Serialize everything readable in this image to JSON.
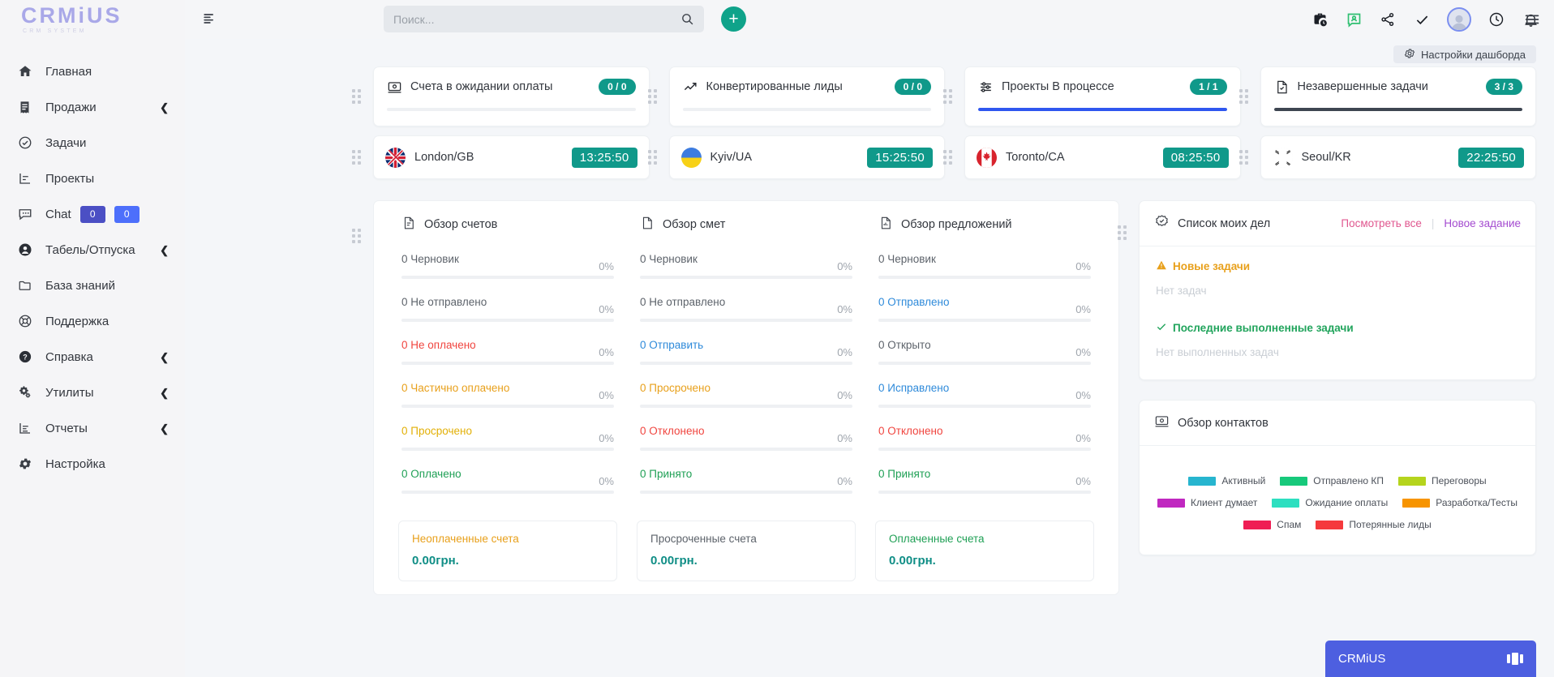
{
  "brand": {
    "name": "CRMiUS",
    "tagline": "CRM SYSTEM",
    "logo_color": "#a9a8e8"
  },
  "sidebar": {
    "items": [
      {
        "label": "Главная",
        "icon": "home-icon",
        "chevron": false
      },
      {
        "label": "Продажи",
        "icon": "receipt-icon",
        "chevron": true
      },
      {
        "label": "Задачи",
        "icon": "check-circle-icon",
        "chevron": false
      },
      {
        "label": "Проекты",
        "icon": "chart-icon",
        "chevron": false
      },
      {
        "label": "Chat",
        "icon": "chat-icon",
        "chevron": false,
        "badges": [
          "0",
          "0"
        ]
      },
      {
        "label": "Табель/Отпуска",
        "icon": "user-icon",
        "chevron": true
      },
      {
        "label": "База знаний",
        "icon": "folder-icon",
        "chevron": false
      },
      {
        "label": "Поддержка",
        "icon": "lifebuoy-icon",
        "chevron": false
      },
      {
        "label": "Справка",
        "icon": "question-icon",
        "chevron": true
      },
      {
        "label": "Утилиты",
        "icon": "gears-icon",
        "chevron": true
      },
      {
        "label": "Отчеты",
        "icon": "report-icon",
        "chevron": true
      },
      {
        "label": "Настройка",
        "icon": "gear-icon",
        "chevron": false
      }
    ],
    "badge_colors": [
      "#4b4fc4",
      "#4d6ffb"
    ]
  },
  "topbar": {
    "menu_icon": "menu-icon",
    "search": {
      "placeholder": "Поиск...",
      "value": "",
      "icon": "search-icon"
    },
    "add_button": {
      "label": "+",
      "color": "#0fa38a"
    },
    "icons": [
      "briefcase-clock-icon",
      "message-user-icon",
      "share-icon",
      "check-icon",
      "avatar",
      "clock-icon",
      "bell-icon"
    ],
    "right_menu_icon": "hamburger-icon"
  },
  "settings_button": {
    "label": "Настройки дашборда",
    "icon": "gear-icon"
  },
  "kpi_cards": [
    {
      "title": "Счета в ожидании оплаты",
      "value": "0 / 0",
      "icon": "invoice-icon",
      "progress": 0,
      "bar_color": "#2f57ef"
    },
    {
      "title": "Конвертированные лиды",
      "value": "0 / 0",
      "icon": "trend-up-icon",
      "progress": 0,
      "bar_color": "#2f57ef"
    },
    {
      "title": "Проекты В процессе",
      "value": "1 / 1",
      "icon": "sliders-icon",
      "progress": 100,
      "bar_color": "#2f57ef"
    },
    {
      "title": "Незавершенные задачи",
      "value": "3 / 3",
      "icon": "task-doc-icon",
      "progress": 100,
      "bar_color": "#3e4651"
    }
  ],
  "clocks": [
    {
      "city": "London/GB",
      "time": "13:25:50",
      "flag": "gb"
    },
    {
      "city": "Kyiv/UA",
      "time": "15:25:50",
      "flag": "ua"
    },
    {
      "city": "Toronto/CA",
      "time": "08:25:50",
      "flag": "ca"
    },
    {
      "city": "Seoul/KR",
      "time": "22:25:50",
      "flag": "kr"
    }
  ],
  "overviews": [
    {
      "title": "Обзор счетов",
      "icon": "invoice-doc-icon",
      "rows": [
        {
          "label": "0 Черновик",
          "pct": "0%",
          "color": "grey"
        },
        {
          "label": "0 Не отправлено",
          "pct": "0%",
          "color": "grey"
        },
        {
          "label": "0 Не оплачено",
          "pct": "0%",
          "color": "red"
        },
        {
          "label": "0 Частично оплачено",
          "pct": "0%",
          "color": "orange"
        },
        {
          "label": "0 Просрочено",
          "pct": "0%",
          "color": "yellow"
        },
        {
          "label": "0 Оплачено",
          "pct": "0%",
          "color": "green"
        }
      ]
    },
    {
      "title": "Обзор смет",
      "icon": "estimate-doc-icon",
      "rows": [
        {
          "label": "0 Черновик",
          "pct": "0%",
          "color": "grey"
        },
        {
          "label": "0 Не отправлено",
          "pct": "0%",
          "color": "grey"
        },
        {
          "label": "0 Отправить",
          "pct": "0%",
          "color": "blue"
        },
        {
          "label": "0 Просрочено",
          "pct": "0%",
          "color": "orange"
        },
        {
          "label": "0 Отклонено",
          "pct": "0%",
          "color": "red"
        },
        {
          "label": "0 Принято",
          "pct": "0%",
          "color": "green"
        }
      ]
    },
    {
      "title": "Обзор предложений",
      "icon": "proposal-doc-icon",
      "rows": [
        {
          "label": "0 Черновик",
          "pct": "0%",
          "color": "grey"
        },
        {
          "label": "0 Отправлено",
          "pct": "0%",
          "color": "blue"
        },
        {
          "label": "0 Открыто",
          "pct": "0%",
          "color": "grey"
        },
        {
          "label": "0 Исправлено",
          "pct": "0%",
          "color": "blue"
        },
        {
          "label": "0 Отклонено",
          "pct": "0%",
          "color": "red"
        },
        {
          "label": "0 Принято",
          "pct": "0%",
          "color": "green"
        }
      ]
    }
  ],
  "totals": [
    {
      "label": "Неоплаченные счета",
      "value": "0.00грн.",
      "color": "orange"
    },
    {
      "label": "Просроченные счета",
      "value": "0.00грн.",
      "color": "grey"
    },
    {
      "label": "Оплаченные счета",
      "value": "0.00грн.",
      "color": "green"
    }
  ],
  "todo": {
    "title": "Список моих дел",
    "icon": "check-badge-icon",
    "link_view_all": "Посмотреть все",
    "link_new_task": "Новое задание",
    "new_section": "Новые задачи",
    "new_empty": "Нет задач",
    "done_section": "Последние выполненные задачи",
    "done_empty": "Нет выполненных задач"
  },
  "contacts": {
    "title": "Обзор контактов",
    "icon": "contacts-icon",
    "legend": [
      {
        "label": "Активный",
        "color": "#27b5cf"
      },
      {
        "label": "Отправлено КП",
        "color": "#17c97b"
      },
      {
        "label": "Переговоры",
        "color": "#b5d41d"
      },
      {
        "label": "Клиент думает",
        "color": "#c028c0"
      },
      {
        "label": "Ожидание оплаты",
        "color": "#2ddfc0"
      },
      {
        "label": "Разработка/Тесты",
        "color": "#f79400"
      },
      {
        "label": "Спам",
        "color": "#ef1d54"
      },
      {
        "label": "Потерянные лиды",
        "color": "#f5393c"
      }
    ]
  },
  "chat_widget": {
    "label": "CRMiUS",
    "icon": "chat-bars-icon",
    "color": "#4d5fe0"
  }
}
